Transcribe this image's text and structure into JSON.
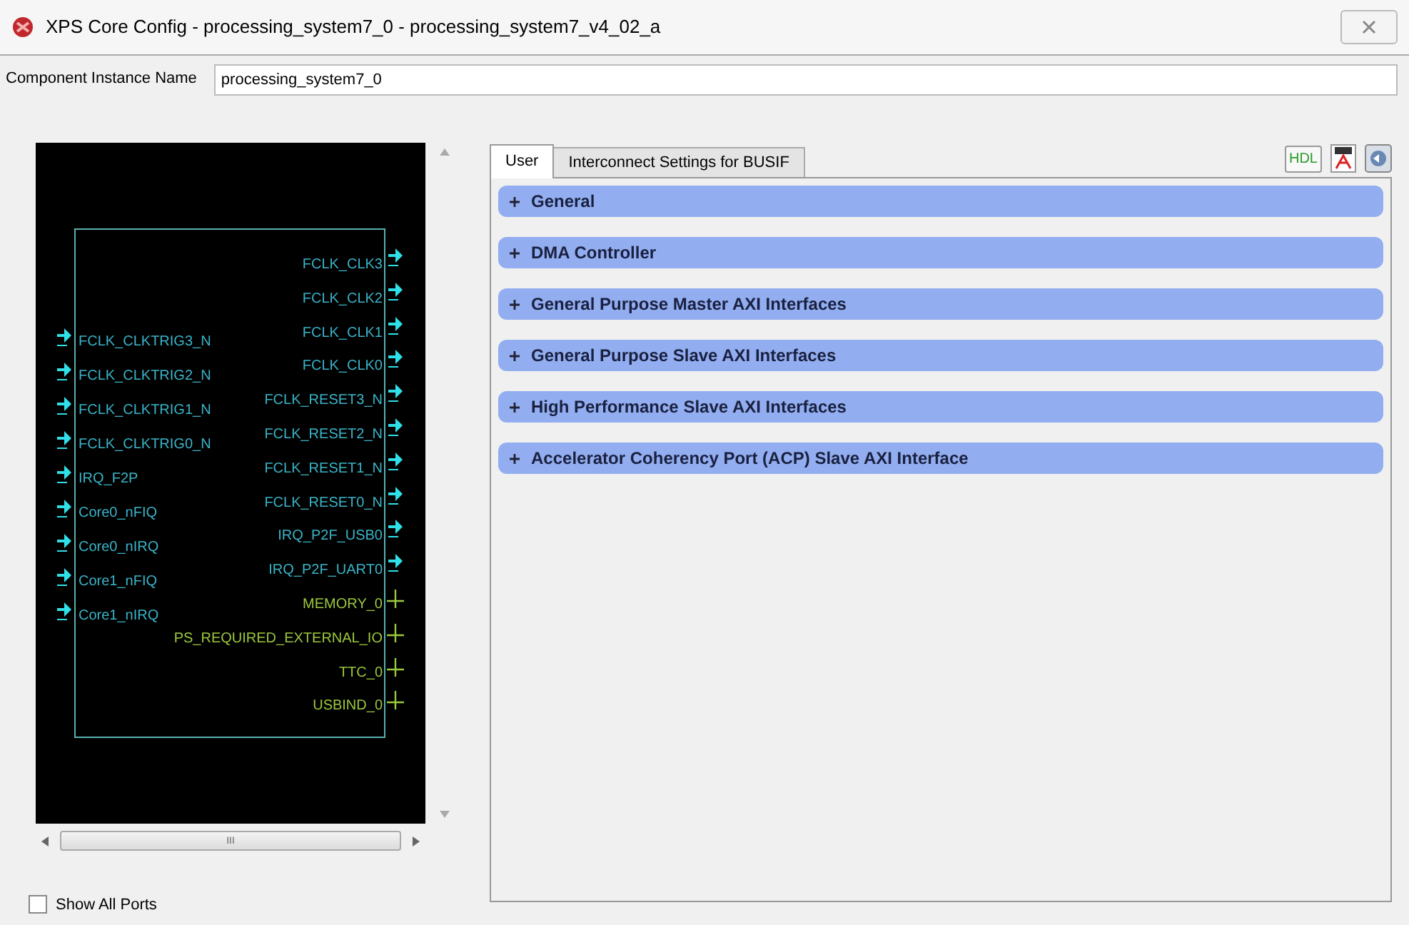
{
  "window": {
    "title": "XPS Core Config - processing_system7_0 - processing_system7_v4_02_a"
  },
  "instance": {
    "label": "Component Instance Name",
    "value": "processing_system7_0"
  },
  "diagram": {
    "left_ports": [
      {
        "name": "FCLK_CLKTRIG3_N",
        "kind": "signal"
      },
      {
        "name": "FCLK_CLKTRIG2_N",
        "kind": "signal"
      },
      {
        "name": "FCLK_CLKTRIG1_N",
        "kind": "signal"
      },
      {
        "name": "FCLK_CLKTRIG0_N",
        "kind": "signal"
      },
      {
        "name": "IRQ_F2P",
        "kind": "signal"
      },
      {
        "name": "Core0_nFIQ",
        "kind": "signal"
      },
      {
        "name": "Core0_nIRQ",
        "kind": "signal"
      },
      {
        "name": "Core1_nFIQ",
        "kind": "signal"
      },
      {
        "name": "Core1_nIRQ",
        "kind": "signal"
      }
    ],
    "right_ports": [
      {
        "name": "FCLK_CLK3",
        "kind": "signal"
      },
      {
        "name": "FCLK_CLK2",
        "kind": "signal"
      },
      {
        "name": "FCLK_CLK1",
        "kind": "signal"
      },
      {
        "name": "FCLK_CLK0",
        "kind": "signal"
      },
      {
        "name": "FCLK_RESET3_N",
        "kind": "signal"
      },
      {
        "name": "FCLK_RESET2_N",
        "kind": "signal"
      },
      {
        "name": "FCLK_RESET1_N",
        "kind": "signal"
      },
      {
        "name": "FCLK_RESET0_N",
        "kind": "signal"
      },
      {
        "name": "IRQ_P2F_USB0",
        "kind": "signal"
      },
      {
        "name": "IRQ_P2F_UART0",
        "kind": "signal"
      },
      {
        "name": "MEMORY_0",
        "kind": "bus"
      },
      {
        "name": "PS_REQUIRED_EXTERNAL_IO",
        "kind": "bus"
      },
      {
        "name": "TTC_0",
        "kind": "bus"
      },
      {
        "name": "USBIND_0",
        "kind": "bus"
      }
    ]
  },
  "hscroll": {
    "grip": "III"
  },
  "show_all_ports": {
    "label": "Show All Ports",
    "checked": false
  },
  "tabs": [
    {
      "label": "User",
      "selected": true
    },
    {
      "label": "Interconnect Settings for BUSIF",
      "selected": false
    }
  ],
  "sections": [
    {
      "label": "General",
      "expanded": false
    },
    {
      "label": "DMA Controller",
      "expanded": false
    },
    {
      "label": "General Purpose Master AXI Interfaces",
      "expanded": false
    },
    {
      "label": "General Purpose Slave AXI Interfaces",
      "expanded": false
    },
    {
      "label": "High Performance Slave AXI Interfaces",
      "expanded": false
    },
    {
      "label": "Accelerator Coherency Port (ACP) Slave AXI Interface",
      "expanded": false
    }
  ],
  "toolbar": {
    "hdl_label": "HDL"
  }
}
